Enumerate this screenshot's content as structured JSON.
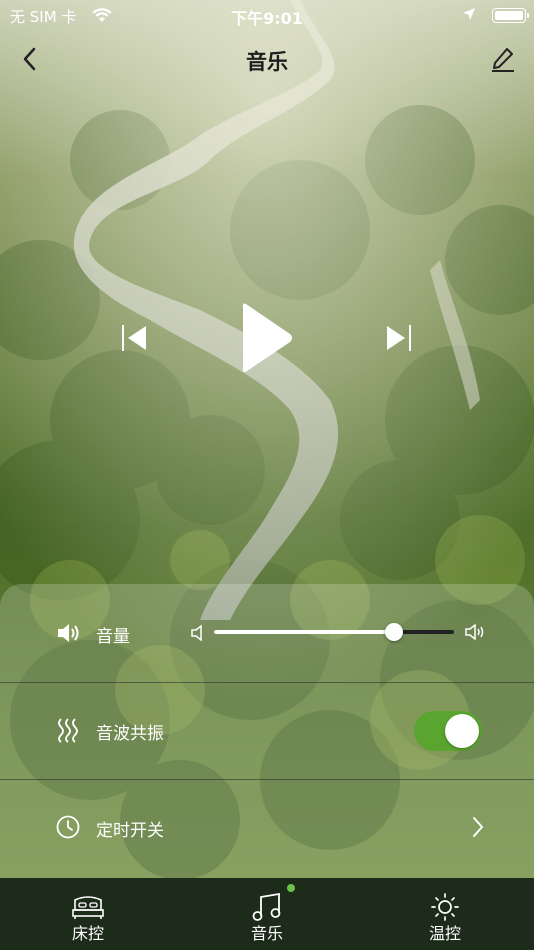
{
  "status_bar": {
    "carrier": "无 SIM 卡",
    "time": "下午9:01",
    "icons": [
      "wifi-icon",
      "location-arrow-icon",
      "battery-icon"
    ]
  },
  "nav": {
    "title": "音乐",
    "back_icon": "chevron-left-icon",
    "edit_icon": "pencil-icon"
  },
  "player": {
    "controls": [
      "previous-track-icon",
      "play-icon",
      "next-track-icon"
    ]
  },
  "settings": {
    "volume": {
      "label": "音量",
      "level": 0.75
    },
    "resonance": {
      "label": "音波共振",
      "enabled": true
    },
    "timer": {
      "label": "定时开关"
    }
  },
  "tabs": [
    {
      "label": "床控",
      "icon": "bed-icon",
      "active": false
    },
    {
      "label": "音乐",
      "icon": "music-note-icon",
      "active": true
    },
    {
      "label": "温控",
      "icon": "sun-icon",
      "active": false
    }
  ],
  "colors": {
    "accent": "#5aa52f",
    "tab_bar": "#1d2b1a",
    "active_dot": "#6cc24a"
  }
}
